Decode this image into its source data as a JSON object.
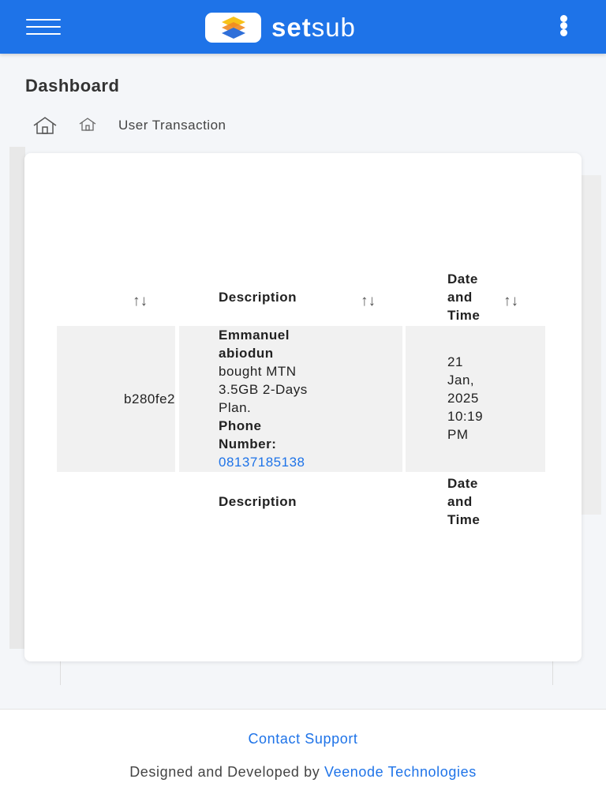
{
  "header": {
    "brand_bold": "set",
    "brand_light": "sub",
    "menu_icon": "hamburger-icon",
    "more_icon": "kebab-menu-icon",
    "background_color": "#1e73e8"
  },
  "page": {
    "title": "Dashboard",
    "breadcrumb": {
      "home_icon": "home-icon",
      "sub_icon": "home-icon",
      "current": "User Transaction"
    }
  },
  "table": {
    "columns": [
      {
        "label": "",
        "sort_icon": "sort-arrows-icon"
      },
      {
        "label": "Description",
        "sort_icon": "sort-arrows-icon"
      },
      {
        "label_lines": [
          "Date",
          "and",
          "Time"
        ],
        "sort_icon": "sort-arrows-icon"
      }
    ],
    "sort_glyph": "↑↓",
    "rows": [
      {
        "reference": "b280fe2",
        "description": {
          "name_lines": [
            "Emmanuel",
            "abiodun"
          ],
          "text_lines": [
            "bought MTN",
            "3.5GB 2-Days",
            "Plan."
          ],
          "phone_label_lines": [
            "Phone",
            "Number:"
          ],
          "phone": "08137185138"
        },
        "datetime_lines": [
          "21",
          "Jan,",
          "2025",
          "10:19",
          "PM"
        ]
      }
    ],
    "footer_columns": [
      {
        "label": "Description"
      },
      {
        "label_lines": [
          "Date",
          "and",
          "Time"
        ]
      }
    ]
  },
  "footer": {
    "contact": "Contact Support",
    "credit_prefix": "Designed and Developed by",
    "credit_link": "Veenode Technologies"
  },
  "colors": {
    "accent": "#1e73e8",
    "page_bg": "#f4f6f9",
    "cell_bg": "#f1f1f1"
  }
}
